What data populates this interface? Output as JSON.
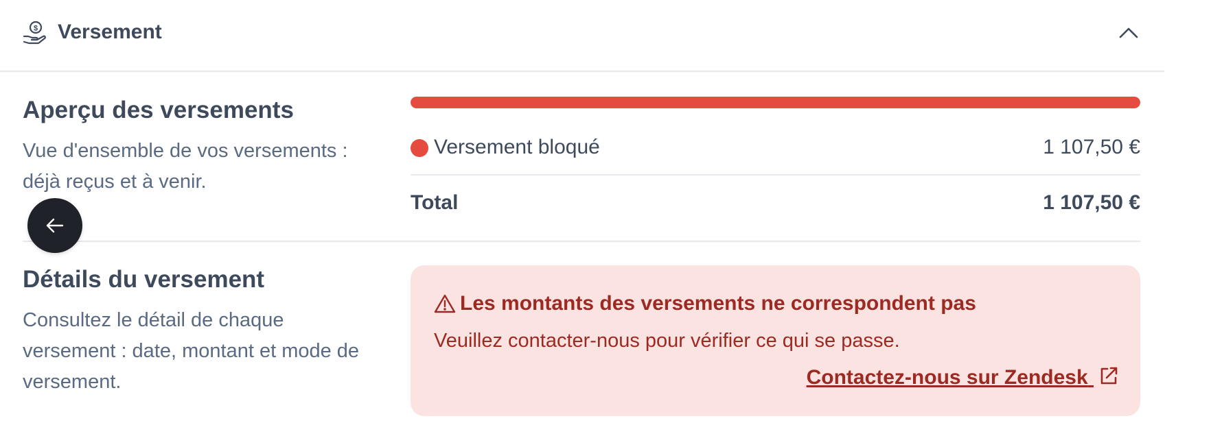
{
  "header": {
    "title": "Versement",
    "icon": "hand-coin-icon",
    "collapse_icon": "chevron-up-icon"
  },
  "overview": {
    "title": "Aperçu des versements",
    "description": "Vue d'ensemble de vos versements : déjà reçus et à venir.",
    "progress": {
      "blocked_fraction": 1.0,
      "color": "#e54b3f"
    },
    "rows": [
      {
        "label": "Versement bloqué",
        "amount": "1 107,50 €",
        "color": "#e54b3f"
      }
    ],
    "total": {
      "label": "Total",
      "amount": "1 107,50 €"
    }
  },
  "details": {
    "title": "Détails du versement",
    "description": "Consultez le détail de chaque versement : date, montant et mode de versement."
  },
  "alert": {
    "icon": "warning-triangle-icon",
    "title": "Les montants des versements ne correspondent pas",
    "text": "Veuillez contacter-nous pour vérifier ce qui se passe.",
    "link_label": "Contactez-nous sur Zendesk",
    "link_icon": "external-link-icon",
    "background": "#fbe3e2",
    "text_color": "#9c2a22"
  },
  "back_button": {
    "icon": "arrow-left-icon"
  }
}
